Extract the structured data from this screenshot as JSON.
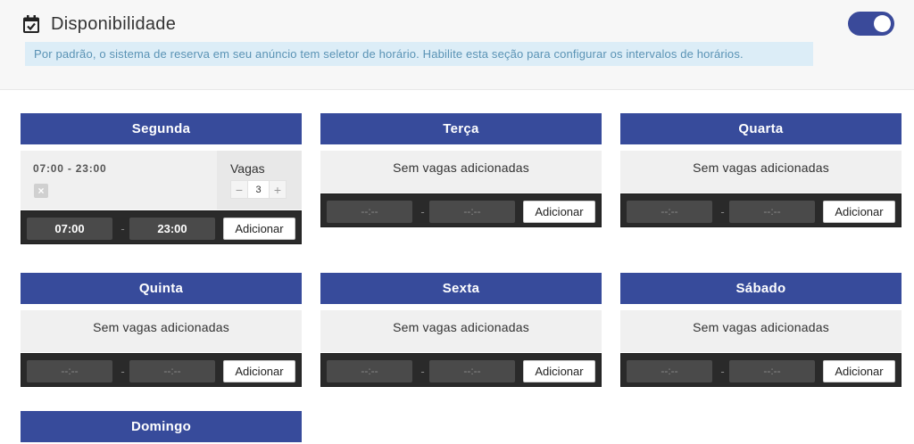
{
  "header": {
    "title": "Disponibilidade",
    "info": "Por padrão, o sistema de reserva em seu anúncio tem seletor de horário. Habilite esta seção para configurar os intervalos de horários.",
    "toggle_on": true,
    "accent_color": "#374b9b"
  },
  "common": {
    "empty_text": "Sem vagas adicionadas",
    "placeholder": "--:--",
    "dash": "-",
    "add_label": "Adicionar",
    "vagas_label": "Vagas",
    "minus": "−",
    "plus": "+",
    "delete": "×"
  },
  "days": [
    {
      "name": "Segunda",
      "slots": [
        {
          "time": "07:00 - 23:00",
          "vagas": "3"
        }
      ],
      "start_value": "07:00",
      "end_value": "23:00"
    },
    {
      "name": "Terça",
      "slots": []
    },
    {
      "name": "Quarta",
      "slots": []
    },
    {
      "name": "Quinta",
      "slots": []
    },
    {
      "name": "Sexta",
      "slots": []
    },
    {
      "name": "Sábado",
      "slots": []
    },
    {
      "name": "Domingo",
      "slots": []
    }
  ]
}
